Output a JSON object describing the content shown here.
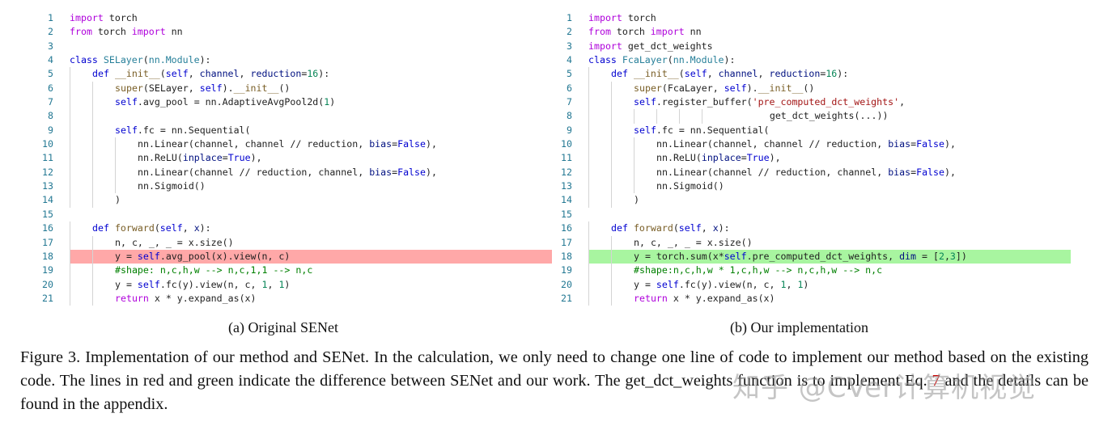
{
  "left_panel": {
    "subcaption": "(a) Original SENet",
    "highlight_color": "#ffa8a8",
    "lines": [
      {
        "no": "1",
        "i": 0,
        "t": [
          [
            "k",
            "import"
          ],
          [
            "",
            " torch"
          ]
        ]
      },
      {
        "no": "2",
        "i": 0,
        "t": [
          [
            "k",
            "from"
          ],
          [
            "",
            " torch "
          ],
          [
            "k",
            "import"
          ],
          [
            "",
            " nn"
          ]
        ]
      },
      {
        "no": "3",
        "i": 0,
        "t": []
      },
      {
        "no": "4",
        "i": 0,
        "t": [
          [
            "d",
            "class"
          ],
          [
            "",
            " "
          ],
          [
            "t",
            "SELayer"
          ],
          [
            "",
            "("
          ],
          [
            "t",
            "nn.Module"
          ],
          [
            "",
            "):"
          ]
        ]
      },
      {
        "no": "5",
        "i": 1,
        "t": [
          [
            "d",
            "def"
          ],
          [
            "",
            " "
          ],
          [
            "f",
            "__init__"
          ],
          [
            "",
            "("
          ],
          [
            "d",
            "self"
          ],
          [
            "",
            ", "
          ],
          [
            "p",
            "channel"
          ],
          [
            "",
            ", "
          ],
          [
            "p",
            "reduction"
          ],
          [
            "",
            "="
          ],
          [
            "n",
            "16"
          ],
          [
            "",
            "):"
          ]
        ]
      },
      {
        "no": "6",
        "i": 2,
        "t": [
          [
            "f",
            "super"
          ],
          [
            "",
            "(SELayer, "
          ],
          [
            "d",
            "self"
          ],
          [
            "",
            ")."
          ],
          [
            "f",
            "__init__"
          ],
          [
            "",
            "()"
          ]
        ]
      },
      {
        "no": "7",
        "i": 2,
        "t": [
          [
            "d",
            "self"
          ],
          [
            "",
            ".avg_pool = nn.AdaptiveAvgPool2d("
          ],
          [
            "n",
            "1"
          ],
          [
            "",
            ")"
          ]
        ]
      },
      {
        "no": "8",
        "i": 2,
        "t": []
      },
      {
        "no": "9",
        "i": 2,
        "t": [
          [
            "d",
            "self"
          ],
          [
            "",
            ".fc = nn.Sequential("
          ]
        ]
      },
      {
        "no": "10",
        "i": 3,
        "t": [
          [
            "",
            "nn.Linear(channel, channel // reduction, "
          ],
          [
            "p",
            "bias"
          ],
          [
            "",
            "="
          ],
          [
            "d",
            "False"
          ],
          [
            "",
            "),"
          ]
        ]
      },
      {
        "no": "11",
        "i": 3,
        "t": [
          [
            "",
            "nn.ReLU("
          ],
          [
            "p",
            "inplace"
          ],
          [
            "",
            "="
          ],
          [
            "d",
            "True"
          ],
          [
            "",
            "),"
          ]
        ]
      },
      {
        "no": "12",
        "i": 3,
        "t": [
          [
            "",
            "nn.Linear(channel // reduction, channel, "
          ],
          [
            "p",
            "bias"
          ],
          [
            "",
            "="
          ],
          [
            "d",
            "False"
          ],
          [
            "",
            "),"
          ]
        ]
      },
      {
        "no": "13",
        "i": 3,
        "t": [
          [
            "",
            "nn.Sigmoid()"
          ]
        ]
      },
      {
        "no": "14",
        "i": 2,
        "t": [
          [
            "",
            ")"
          ]
        ]
      },
      {
        "no": "15",
        "i": 0,
        "t": []
      },
      {
        "no": "16",
        "i": 1,
        "t": [
          [
            "d",
            "def"
          ],
          [
            "",
            " "
          ],
          [
            "f",
            "forward"
          ],
          [
            "",
            "("
          ],
          [
            "d",
            "self"
          ],
          [
            "",
            ", "
          ],
          [
            "p",
            "x"
          ],
          [
            "",
            "):"
          ]
        ]
      },
      {
        "no": "17",
        "i": 2,
        "t": [
          [
            "",
            "n, c, _, _ = x.size()"
          ]
        ]
      },
      {
        "no": "18",
        "i": 2,
        "hl": "red",
        "t": [
          [
            "",
            "y = "
          ],
          [
            "d",
            "self"
          ],
          [
            "",
            ".avg_pool(x).view(n, c)"
          ]
        ]
      },
      {
        "no": "19",
        "i": 2,
        "t": [
          [
            "c",
            "#shape: n,c,h,w --> n,c,1,1 --> n,c"
          ]
        ]
      },
      {
        "no": "20",
        "i": 2,
        "t": [
          [
            "",
            "y = "
          ],
          [
            "d",
            "self"
          ],
          [
            "",
            ".fc(y).view(n, c, "
          ],
          [
            "n",
            "1"
          ],
          [
            "",
            ", "
          ],
          [
            "n",
            "1"
          ],
          [
            "",
            ")"
          ]
        ]
      },
      {
        "no": "21",
        "i": 2,
        "t": [
          [
            "k",
            "return"
          ],
          [
            "",
            " x * y.expand_as(x)"
          ]
        ]
      }
    ]
  },
  "right_panel": {
    "subcaption": "(b) Our implementation",
    "highlight_color": "#a8f5a0",
    "lines": [
      {
        "no": "1",
        "i": 0,
        "t": [
          [
            "k",
            "import"
          ],
          [
            "",
            " torch"
          ]
        ]
      },
      {
        "no": "2",
        "i": 0,
        "t": [
          [
            "k",
            "from"
          ],
          [
            "",
            " torch "
          ],
          [
            "k",
            "import"
          ],
          [
            "",
            " nn"
          ]
        ]
      },
      {
        "no": "3",
        "i": 0,
        "t": [
          [
            "k",
            "import"
          ],
          [
            "",
            " get_dct_weights"
          ]
        ]
      },
      {
        "no": "4",
        "i": 0,
        "t": [
          [
            "d",
            "class"
          ],
          [
            "",
            " "
          ],
          [
            "t",
            "FcaLayer"
          ],
          [
            "",
            "("
          ],
          [
            "t",
            "nn.Module"
          ],
          [
            "",
            "):"
          ]
        ]
      },
      {
        "no": "5",
        "i": 1,
        "t": [
          [
            "d",
            "def"
          ],
          [
            "",
            " "
          ],
          [
            "f",
            "__init__"
          ],
          [
            "",
            "("
          ],
          [
            "d",
            "self"
          ],
          [
            "",
            ", "
          ],
          [
            "p",
            "channel"
          ],
          [
            "",
            ", "
          ],
          [
            "p",
            "reduction"
          ],
          [
            "",
            "="
          ],
          [
            "n",
            "16"
          ],
          [
            "",
            "):"
          ]
        ]
      },
      {
        "no": "6",
        "i": 2,
        "t": [
          [
            "f",
            "super"
          ],
          [
            "",
            "(FcaLayer, "
          ],
          [
            "d",
            "self"
          ],
          [
            "",
            ")."
          ],
          [
            "f",
            "__init__"
          ],
          [
            "",
            "()"
          ]
        ]
      },
      {
        "no": "7",
        "i": 2,
        "t": [
          [
            "d",
            "self"
          ],
          [
            "",
            ".register_buffer("
          ],
          [
            "s",
            "'pre_computed_dct_weights'"
          ],
          [
            "",
            ","
          ]
        ]
      },
      {
        "no": "8",
        "i": 6,
        "t": [
          [
            "",
            "        get_dct_weights(...))"
          ]
        ]
      },
      {
        "no": "9",
        "i": 2,
        "t": [
          [
            "d",
            "self"
          ],
          [
            "",
            ".fc = nn.Sequential("
          ]
        ]
      },
      {
        "no": "10",
        "i": 3,
        "t": [
          [
            "",
            "nn.Linear(channel, channel // reduction, "
          ],
          [
            "p",
            "bias"
          ],
          [
            "",
            "="
          ],
          [
            "d",
            "False"
          ],
          [
            "",
            "),"
          ]
        ]
      },
      {
        "no": "11",
        "i": 3,
        "t": [
          [
            "",
            "nn.ReLU("
          ],
          [
            "p",
            "inplace"
          ],
          [
            "",
            "="
          ],
          [
            "d",
            "True"
          ],
          [
            "",
            "),"
          ]
        ]
      },
      {
        "no": "12",
        "i": 3,
        "t": [
          [
            "",
            "nn.Linear(channel // reduction, channel, "
          ],
          [
            "p",
            "bias"
          ],
          [
            "",
            "="
          ],
          [
            "d",
            "False"
          ],
          [
            "",
            "),"
          ]
        ]
      },
      {
        "no": "13",
        "i": 3,
        "t": [
          [
            "",
            "nn.Sigmoid()"
          ]
        ]
      },
      {
        "no": "14",
        "i": 2,
        "t": [
          [
            "",
            ")"
          ]
        ]
      },
      {
        "no": "15",
        "i": 0,
        "t": []
      },
      {
        "no": "16",
        "i": 1,
        "t": [
          [
            "d",
            "def"
          ],
          [
            "",
            " "
          ],
          [
            "f",
            "forward"
          ],
          [
            "",
            "("
          ],
          [
            "d",
            "self"
          ],
          [
            "",
            ", "
          ],
          [
            "p",
            "x"
          ],
          [
            "",
            "):"
          ]
        ]
      },
      {
        "no": "17",
        "i": 2,
        "t": [
          [
            "",
            "n, c, _, _ = x.size()"
          ]
        ]
      },
      {
        "no": "18",
        "i": 2,
        "hl": "green",
        "t": [
          [
            "",
            "y = torch.sum(x*"
          ],
          [
            "d",
            "self"
          ],
          [
            "",
            ".pre_computed_dct_weights, "
          ],
          [
            "p",
            "dim"
          ],
          [
            "",
            " = ["
          ],
          [
            "n",
            "2"
          ],
          [
            "",
            ","
          ],
          [
            "n",
            "3"
          ],
          [
            "",
            "])"
          ]
        ]
      },
      {
        "no": "19",
        "i": 2,
        "t": [
          [
            "c",
            "#shape:n,c,h,w * 1,c,h,w --> n,c,h,w --> n,c"
          ]
        ]
      },
      {
        "no": "20",
        "i": 2,
        "t": [
          [
            "",
            "y = "
          ],
          [
            "d",
            "self"
          ],
          [
            "",
            ".fc(y).view(n, c, "
          ],
          [
            "n",
            "1"
          ],
          [
            "",
            ", "
          ],
          [
            "n",
            "1"
          ],
          [
            "",
            ")"
          ]
        ]
      },
      {
        "no": "21",
        "i": 2,
        "t": [
          [
            "k",
            "return"
          ],
          [
            "",
            " x * y.expand_as(x)"
          ]
        ]
      }
    ]
  },
  "caption": {
    "part1": "Figure 3. Implementation of our method and SENet. In the calculation, we only need to change one line of code to implement our method based on the existing code. The lines in red and green indicate the difference between SENet and our work. The get_dct_weights function is to implement Eq. ",
    "ref": "7",
    "part2": " and the details can be found in the appendix."
  },
  "watermark": "知乎 @CVer计算机视觉"
}
